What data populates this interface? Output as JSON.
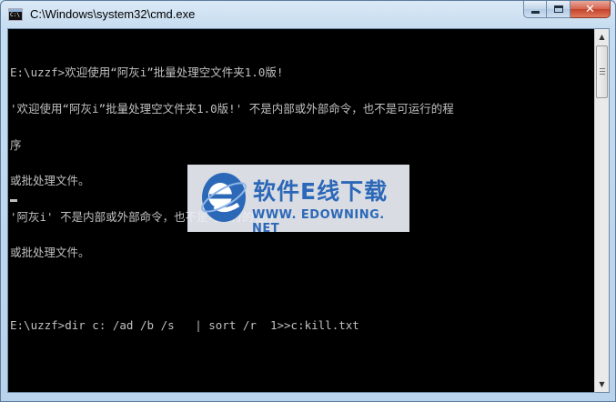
{
  "window": {
    "title": "C:\\Windows\\system32\\cmd.exe",
    "app_icon_text": "C:\\"
  },
  "caption": {
    "minimize_icon": "minimize-icon",
    "maximize_icon": "maximize-icon",
    "close_glyph": "✕"
  },
  "console": {
    "lines": [
      "E:\\uzzf>欢迎使用“阿灰i”批量处理空文件夹1.0版!",
      "'欢迎使用“阿灰i”批量处理空文件夹1.0版!' 不是内部或外部命令，也不是可运行的程",
      "序",
      "或批处理文件。",
      "'阿灰i' 不是内部或外部命令，也不是可运行的程序",
      "或批处理文件。",
      "",
      "E:\\uzzf>dir c: /ad /b /s   | sort /r  1>>c:kill.txt"
    ],
    "colors": {
      "background": "#000000",
      "text": "#c0c0c0"
    }
  },
  "scrollbar": {
    "up_glyph": "▲",
    "down_glyph": "▼"
  },
  "watermark": {
    "title": "软件E线下载",
    "url": "WWW. EDOWNING. NET",
    "color": "#2c68b8"
  }
}
